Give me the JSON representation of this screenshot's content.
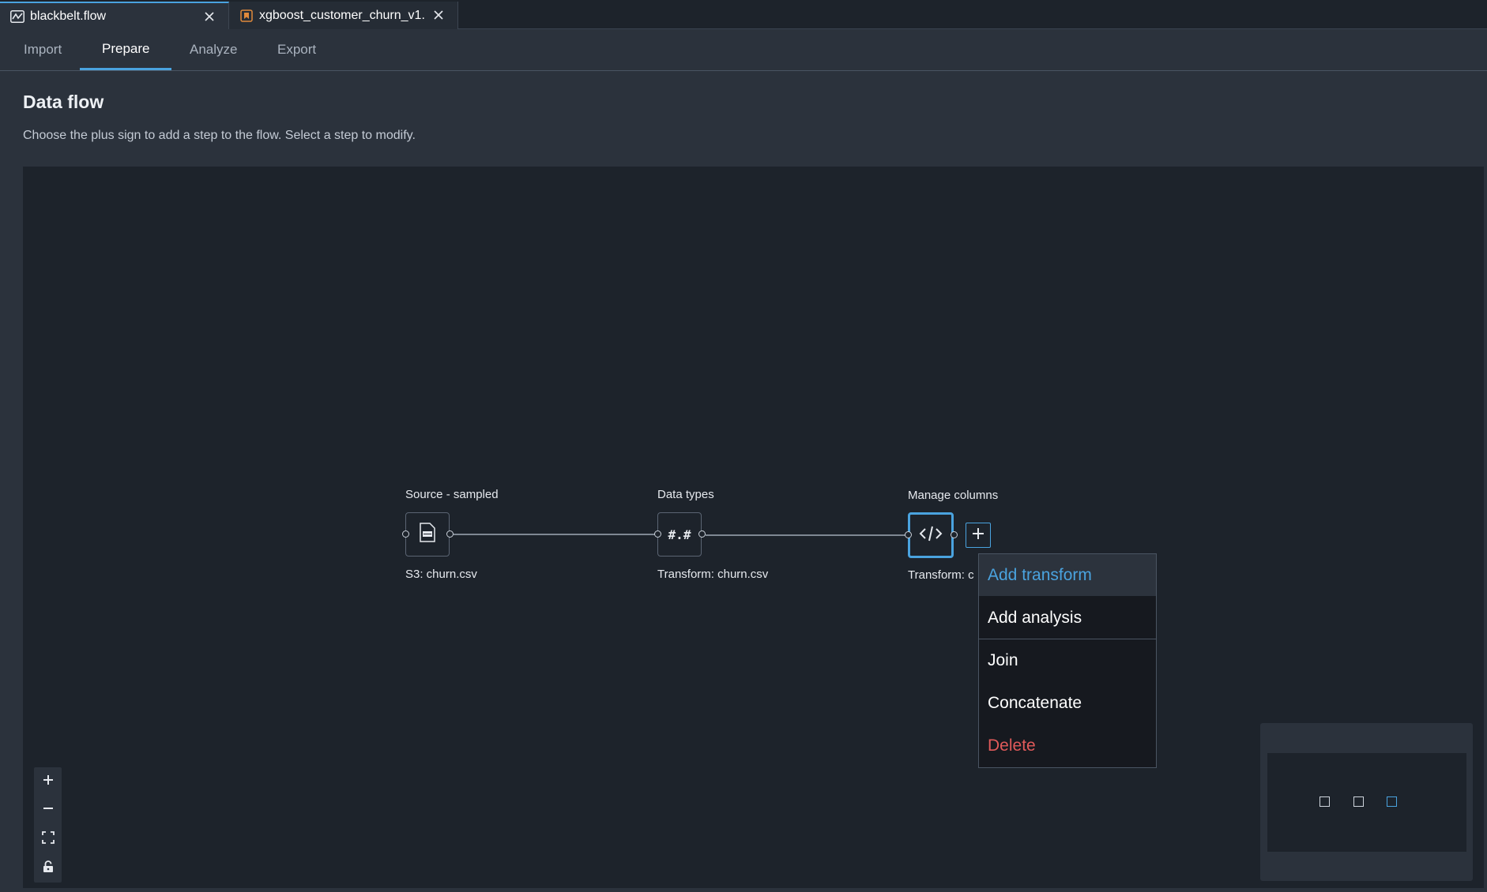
{
  "file_tabs": [
    {
      "label": "blackbelt.flow",
      "icon": "flow-icon",
      "active": true
    },
    {
      "label": "xgboost_customer_churn_v1.",
      "icon": "notebook-icon",
      "active": false
    }
  ],
  "nav_tabs": [
    "Import",
    "Prepare",
    "Analyze",
    "Export"
  ],
  "active_nav_tab": "Prepare",
  "page": {
    "title": "Data flow",
    "subtitle": "Choose the plus sign to add a step to the flow. Select a step to modify."
  },
  "nodes": [
    {
      "title": "Source - sampled",
      "label": "S3: churn.csv",
      "icon": "document-icon"
    },
    {
      "title": "Data types",
      "label": "Transform: churn.csv",
      "icon_text": "#.#"
    },
    {
      "title": "Manage columns",
      "label": "Transform: c",
      "icon": "code-icon",
      "selected": true
    }
  ],
  "context_menu": {
    "items": [
      {
        "label": "Add transform",
        "highlighted": true
      },
      {
        "label": "Add analysis"
      },
      {
        "label": "Join"
      },
      {
        "label": "Concatenate"
      },
      {
        "label": "Delete",
        "danger": true
      }
    ]
  },
  "zoom_controls": [
    "zoom-in-icon",
    "zoom-out-icon",
    "fit-view-icon",
    "lock-icon"
  ],
  "colors": {
    "accent": "#4aa3df",
    "danger": "#e05a5a",
    "canvas_bg": "#1d232b",
    "panel_bg": "#2b323c"
  }
}
